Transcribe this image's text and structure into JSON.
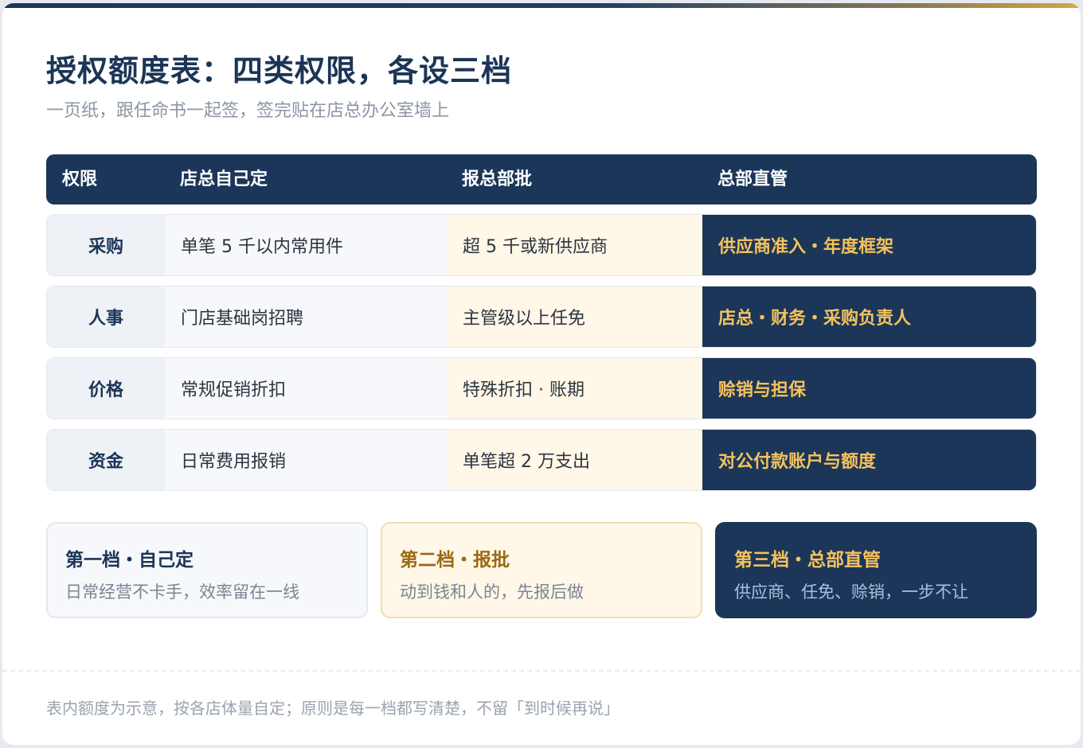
{
  "header": {
    "title": "授权额度表：四类权限，各设三档",
    "subtitle": "一页纸，跟任命书一起签，签完贴在店总办公室墙上"
  },
  "table": {
    "columns": [
      "权限",
      "店总自己定",
      "报总部批",
      "总部直管"
    ],
    "rows": [
      {
        "name": "采购",
        "self": "单笔 5 千以内常用件",
        "report": "超 5 千或新供应商",
        "hq": "供应商准入・年度框架"
      },
      {
        "name": "人事",
        "self": "门店基础岗招聘",
        "report": "主管级以上任免",
        "hq": "店总・财务・采购负责人"
      },
      {
        "name": "价格",
        "self": "常规促销折扣",
        "report": "特殊折扣 · 账期",
        "hq": "赊销与担保"
      },
      {
        "name": "资金",
        "self": "日常费用报销",
        "report": "单笔超 2 万支出",
        "hq": "对公付款账户与额度"
      }
    ]
  },
  "tiers": [
    {
      "title": "第一档・自己定",
      "desc": "日常经营不卡手，效率留在一线"
    },
    {
      "title": "第二档・报批",
      "desc": "动到钱和人的，先报后做"
    },
    {
      "title": "第三档・总部直管",
      "desc": "供应商、任免、赊销，一步不让"
    }
  ],
  "footer": {
    "note": "表内额度为示意，按各店体量自定；原则是每一档都写清楚，不留「到时候再说」"
  },
  "colors": {
    "navy": "#1b3658",
    "gold": "#f5c25c",
    "cream": "#fff7e7"
  }
}
